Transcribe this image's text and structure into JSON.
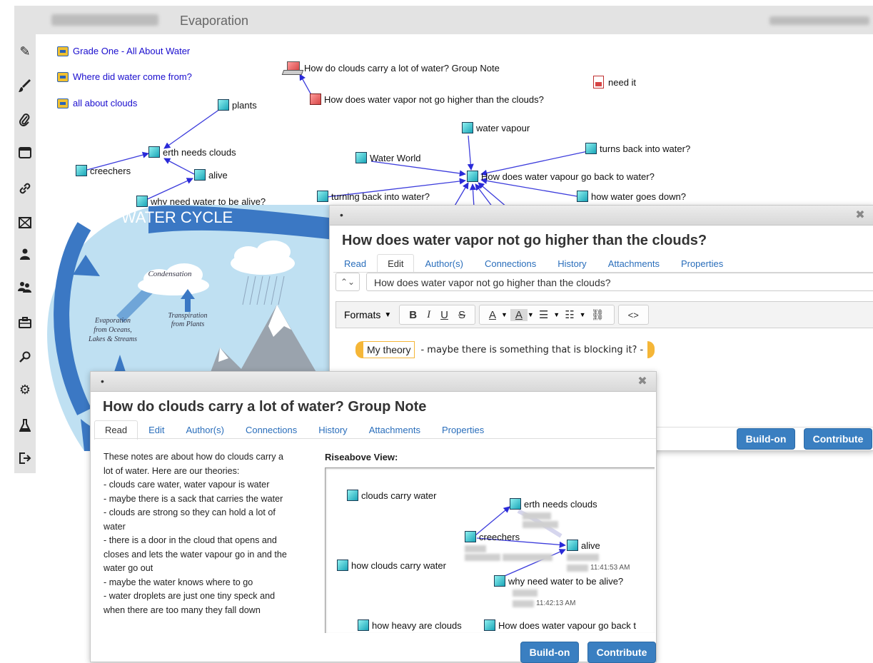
{
  "header": {
    "title": "Evaporation"
  },
  "toolbar": {
    "icons": [
      "pencil-icon",
      "brush-icon",
      "paperclip-icon",
      "window-icon",
      "link-icon",
      "scaffold-icon",
      "user-icon",
      "group-icon",
      "briefcase-icon",
      "search-icon",
      "gear-icon",
      "flask-icon",
      "logout-icon"
    ]
  },
  "canvas": {
    "links": [
      "Grade One - All About Water",
      "Where did water come from?",
      "all about clouds"
    ],
    "notes": {
      "group_note": "How do clouds carry a lot of water? Group Note",
      "vapor_higher": "How does water vapor not go higher than the clouds?",
      "need_it": "need it",
      "plants": "plants",
      "erth": "erth needs clouds",
      "creechers": "creechers",
      "alive": "alive",
      "why_alive": "why need water to be alive?",
      "water_vapour": "water vapour",
      "water_world": "Water World",
      "turns_back": "turns back into water?",
      "vapour_back": "How does water vapour go back to water?",
      "turning_back": "turning back into water?",
      "goes_down": "how water goes down?"
    }
  },
  "water_cycle": {
    "title": "WATER CYCLE",
    "condensation": "Condensation",
    "transpiration": [
      "Transpiration",
      "from Plants"
    ],
    "evaporation": [
      "Evaporation",
      "from Oceans,",
      "Lakes & Streams"
    ]
  },
  "edit_window": {
    "dot": "•",
    "title": "How does water vapor not go higher than the clouds?",
    "tabs": [
      "Read",
      "Edit",
      "Author(s)",
      "Connections",
      "History",
      "Attachments",
      "Properties"
    ],
    "title_input": "How does water vapor not go higher than the clouds?",
    "formats_label": "Formats",
    "scaffold_tag": "My theory",
    "body_text": "- maybe there is something that is blocking it? -",
    "buildon": "Build-on",
    "contribute": "Contribute"
  },
  "read_window": {
    "dot": "•",
    "title": "How do clouds carry a lot of water? Group Note",
    "tabs": [
      "Read",
      "Edit",
      "Author(s)",
      "Connections",
      "History",
      "Attachments",
      "Properties"
    ],
    "body_lines": [
      "These notes are about how do clouds carry a",
      "lot of water. Here are our theories:",
      "- clouds care water, water vapour is water",
      "- maybe there is a sack that carries the water",
      "- clouds are strong so they can hold a lot of",
      "water",
      "- there is a door in the cloud that opens and",
      "closes and lets the water vapour go in and the",
      "water go out",
      "- maybe the water knows where to go",
      "- water droplets are just one tiny speck and",
      "when there are too many they fall down"
    ],
    "riseabove_label": "Riseabove View:",
    "riseabove_notes": {
      "clouds_carry": "clouds carry water",
      "erth": "erth needs clouds",
      "creechers": "creechers",
      "alive": "alive",
      "how_clouds_carry": "how clouds carry water",
      "why_alive": "why need water to be alive?",
      "heavy": "how heavy are clouds",
      "vapour_back": "How does water vapour go back t"
    },
    "riseabove_times": [
      "11:41:53 AM",
      "11:42:13 AM"
    ],
    "buildon": "Build-on",
    "contribute": "Contribute"
  }
}
